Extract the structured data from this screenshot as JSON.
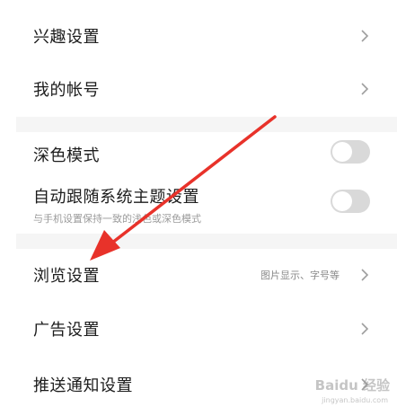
{
  "settings": {
    "interest": {
      "label": "兴趣设置"
    },
    "account": {
      "label": "我的帐号"
    },
    "dark_mode": {
      "label": "深色模式",
      "enabled": false
    },
    "auto_theme": {
      "label": "自动跟随系统主题设置",
      "sublabel": "与手机设置保持一致的浅色或深色模式",
      "enabled": false
    },
    "browse": {
      "label": "浏览设置",
      "hint": "图片显示、字号等"
    },
    "ads": {
      "label": "广告设置"
    },
    "push": {
      "label": "推送通知设置"
    }
  },
  "watermark": {
    "text": "Baidu 经验",
    "sub": "jingyan.baidu.com"
  },
  "colors": {
    "arrow": "#e8322a",
    "toggle_off": "#d9d9d9",
    "band": "#f5f5f5",
    "text": "#1c1c1c"
  }
}
